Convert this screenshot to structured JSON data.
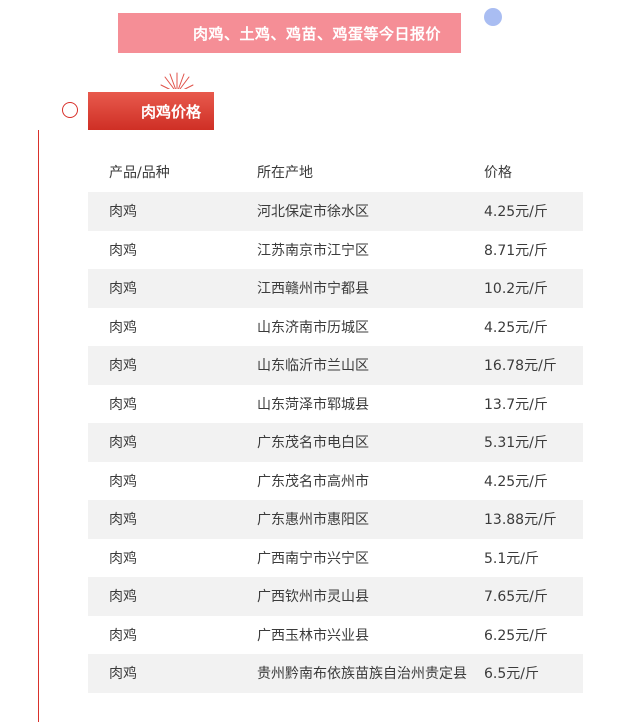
{
  "banner": {
    "title": "肉鸡、土鸡、鸡苗、鸡蛋等今日报价"
  },
  "section": {
    "title": "肉鸡价格"
  },
  "table": {
    "headers": [
      "产品/品种",
      "所在产地",
      "价格"
    ],
    "rows": [
      [
        "肉鸡",
        "河北保定市徐水区",
        "4.25元/斤"
      ],
      [
        "肉鸡",
        "江苏南京市江宁区",
        "8.71元/斤"
      ],
      [
        "肉鸡",
        "江西赣州市宁都县",
        "10.2元/斤"
      ],
      [
        "肉鸡",
        "山东济南市历城区",
        "4.25元/斤"
      ],
      [
        "肉鸡",
        "山东临沂市兰山区",
        "16.78元/斤"
      ],
      [
        "肉鸡",
        "山东菏泽市郓城县",
        "13.7元/斤"
      ],
      [
        "肉鸡",
        "广东茂名市电白区",
        "5.31元/斤"
      ],
      [
        "肉鸡",
        "广东茂名市高州市",
        "4.25元/斤"
      ],
      [
        "肉鸡",
        "广东惠州市惠阳区",
        "13.88元/斤"
      ],
      [
        "肉鸡",
        "广西南宁市兴宁区",
        "5.1元/斤"
      ],
      [
        "肉鸡",
        "广西钦州市灵山县",
        "7.65元/斤"
      ],
      [
        "肉鸡",
        "广西玉林市兴业县",
        "6.25元/斤"
      ],
      [
        "肉鸡",
        "贵州黔南布依族苗族自治州贵定县",
        "6.5元/斤"
      ]
    ]
  },
  "colors": {
    "banner_bg": "#f58e96",
    "accent_red": "#d9312b",
    "decor_dot": "#a9bdf2",
    "row_shade": "#f2f2f2"
  },
  "icons": {
    "firework": "firework-icon",
    "section_marker": "circle-marker-icon"
  }
}
